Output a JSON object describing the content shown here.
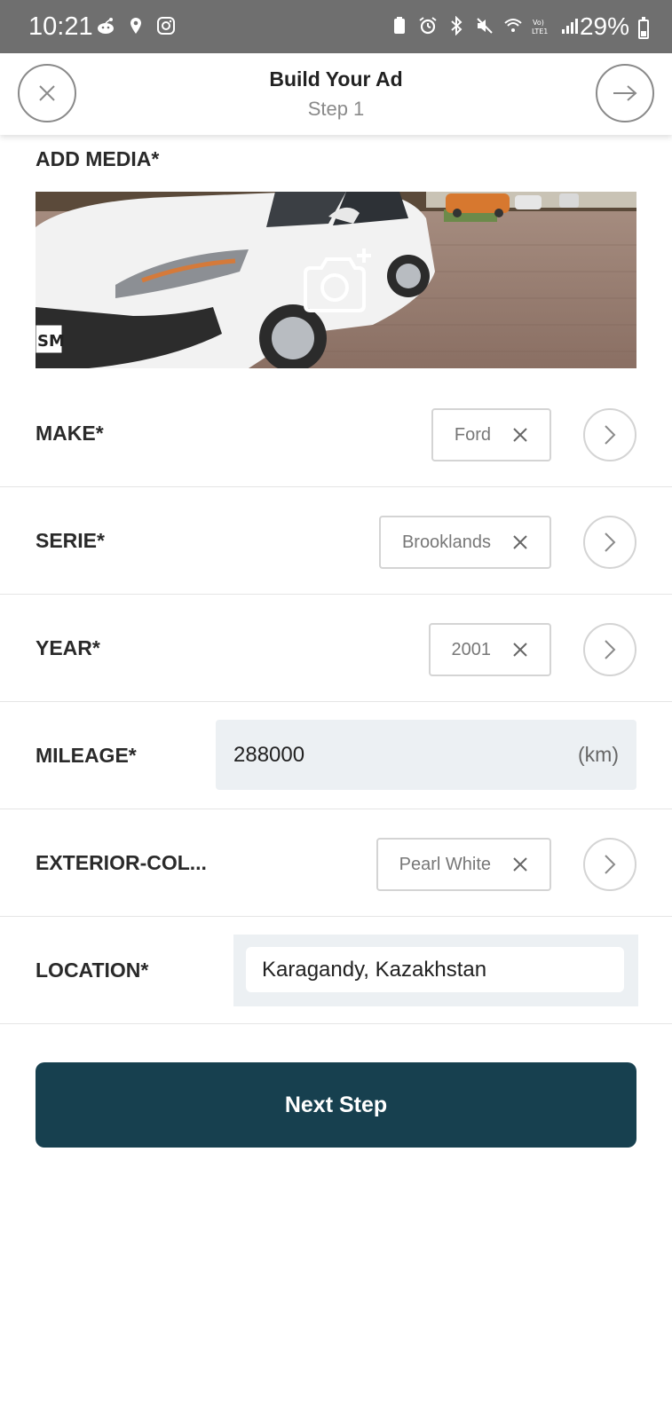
{
  "status_bar": {
    "time": "10:21",
    "battery": "29%",
    "left_icons": [
      "reddit-icon",
      "location-pin-icon",
      "instagram-icon"
    ],
    "right_icons": [
      "battery-saver-icon",
      "alarm-icon",
      "bluetooth-icon",
      "mute-icon",
      "wifi-icon",
      "volte-icon",
      "signal-icon"
    ]
  },
  "header": {
    "title": "Build Your Ad",
    "subtitle": "Step 1"
  },
  "media": {
    "label": "ADD MEDIA*"
  },
  "fields": {
    "make": {
      "label": "MAKE*",
      "value": "Ford"
    },
    "serie": {
      "label": "SERIE*",
      "value": "Brooklands"
    },
    "year": {
      "label": "YEAR*",
      "value": "2001"
    },
    "mileage": {
      "label": "MILEAGE*",
      "value": "288000",
      "unit": "(km)"
    },
    "exterior_color": {
      "label": "EXTERIOR-COL...",
      "value": "Pearl White"
    },
    "location": {
      "label": "LOCATION*",
      "value": "Karagandy, Kazakhstan"
    }
  },
  "next_step_label": "Next Step",
  "colors": {
    "primary_button": "#17404f",
    "input_background": "#ecf0f3",
    "status_bar": "#6f6f6f"
  }
}
